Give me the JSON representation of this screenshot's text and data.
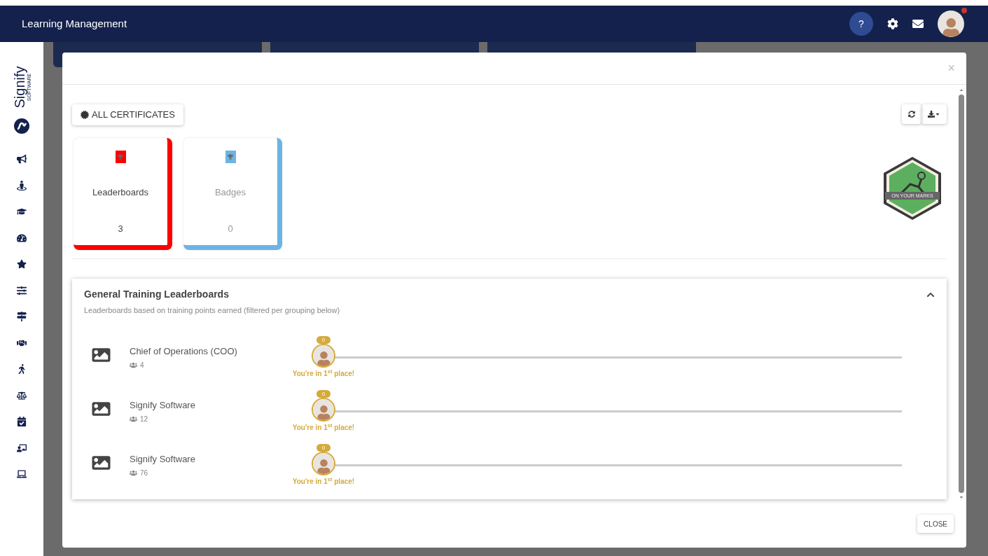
{
  "header": {
    "title": "Learning Management",
    "help": "?",
    "notification": true
  },
  "logo": {
    "name": "Signify",
    "tagline": "SOFTWARE"
  },
  "modal": {
    "close_glyph": "×",
    "filter_button": "ALL CERTIFICATES",
    "footer_button": "CLOSE",
    "cards": [
      {
        "label": "Leaderboards",
        "count": "3",
        "color": "#ff0000",
        "selected": true
      },
      {
        "label": "Badges",
        "count": "0",
        "color": "#6cb4e4",
        "selected": false
      }
    ],
    "badge": {
      "label": "ON YOUR MARKS"
    },
    "panel": {
      "title": "General Training Leaderboards",
      "subtitle": "Leaderboards based on training points earned (filtered per grouping below)",
      "expanded": true,
      "rows": [
        {
          "name": "Chief of Operations (COO)",
          "members": "4",
          "points": "0",
          "placement": "You're in 1$^{st}$ place!"
        },
        {
          "name": "Signify Software",
          "members": "12",
          "points": "0",
          "placement": "You're in 1$^{st}$ place!"
        },
        {
          "name": "Signify Software",
          "members": "76",
          "points": "0",
          "placement": "You're in 1$^{st}$ place!"
        }
      ]
    }
  }
}
